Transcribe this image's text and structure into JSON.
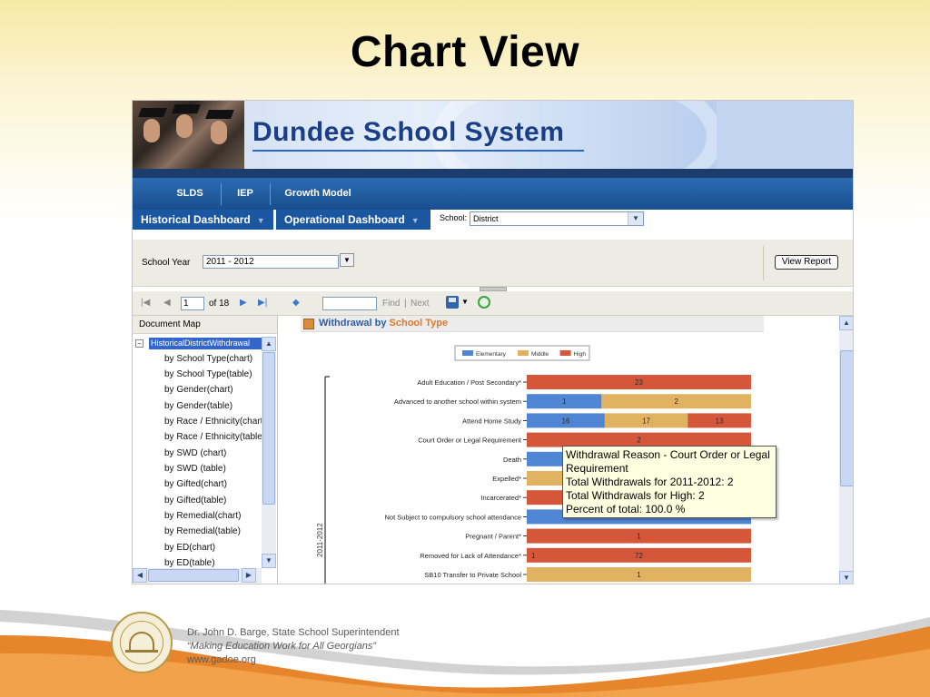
{
  "slide": {
    "title": "Chart View"
  },
  "banner": {
    "title": "Dundee School System"
  },
  "nav_primary": [
    "SLDS",
    "IEP",
    "Growth Model"
  ],
  "nav_secondary": {
    "tabs": [
      "Historical Dashboard",
      "Operational Dashboard"
    ],
    "school_label": "School:",
    "school_value": "District"
  },
  "params": {
    "school_year_label": "School Year",
    "school_year_value": "2011 - 2012",
    "view_report": "View Report"
  },
  "toolbar": {
    "page": "1",
    "of_pages": "of 18",
    "find": "Find",
    "separator": "|",
    "next": "Next",
    "icons": [
      "first-page-icon",
      "previous-page-icon",
      "next-page-icon",
      "last-page-icon",
      "back-icon",
      "export-icon",
      "refresh-icon"
    ]
  },
  "document_map": {
    "header": "Document Map",
    "root": "HistoricalDistrictWithdrawal",
    "items": [
      "by School Type(chart)",
      "by School Type(table)",
      "by Gender(chart)",
      "by Gender(table)",
      "by Race / Ethnicity(chart)",
      "by Race / Ethnicity(table)",
      "by SWD (chart)",
      "by SWD (table)",
      "by Gifted(chart)",
      "by Gifted(table)",
      "by Remedial(chart)",
      "by Remedial(table)",
      "by ED(chart)",
      "by ED(table)"
    ]
  },
  "report": {
    "title_part1": "Withdrawal by",
    "title_part2": "School Type"
  },
  "chart_data": {
    "type": "bar",
    "orientation": "horizontal",
    "stacked": "percent",
    "legend_placement": "top",
    "colors": {
      "Elementary": "#4f86d3",
      "Middle": "#e0b261",
      "High": "#d4573b"
    },
    "group_label": "2011-2012",
    "categories": [
      "Adult Education / Post Secondary*",
      "Advanced to another school within system",
      "Attend Home Study",
      "Court Order or Legal Requirement",
      "Death",
      "Expelled*",
      "Incarcerated*",
      "Not Subject to compulsory school attendance",
      "Pregnant / Parent*",
      "Removed for Lack of Attendance*",
      "SB10 Transfer to Private School"
    ],
    "series": [
      {
        "name": "Elementary",
        "values": [
          0,
          1,
          16,
          0,
          2,
          0,
          0,
          1,
          0,
          0,
          0
        ],
        "labels": [
          "",
          "1",
          "16",
          "",
          "2",
          "",
          "",
          "",
          "",
          "",
          ""
        ]
      },
      {
        "name": "Middle",
        "values": [
          0,
          2,
          17,
          0,
          0,
          1,
          0,
          0,
          0,
          0,
          1
        ],
        "labels": [
          "",
          "2",
          "17",
          "",
          "",
          "1",
          "",
          "",
          "",
          "",
          "1"
        ]
      },
      {
        "name": "High",
        "values": [
          23,
          0,
          13,
          2,
          0,
          0,
          1,
          0,
          1,
          72,
          0
        ],
        "labels": [
          "23",
          "",
          "13",
          "2",
          "",
          "",
          "",
          "",
          "1",
          "72",
          ""
        ]
      }
    ],
    "removed_middle_label": "1"
  },
  "tooltip": {
    "lines": [
      "Withdrawal Reason - Court Order or Legal Requirement",
      "Total Withdrawals for 2011-2012: 2",
      "Total Withdrawals for High: 2",
      "Percent of total: 100.0 %"
    ]
  },
  "footer": {
    "line1": "Dr. John D. Barge, State School Superintendent",
    "line2": "“Making Education Work for All Georgians”",
    "line3": "www.gadoe.org"
  }
}
